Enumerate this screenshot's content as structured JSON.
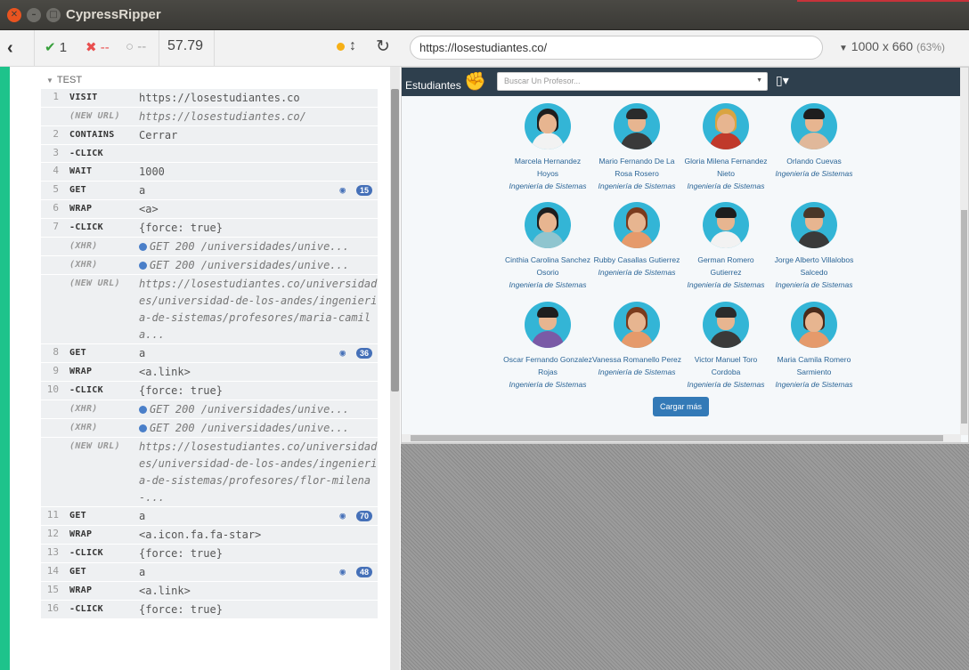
{
  "window": {
    "title": "CypressRipper"
  },
  "toolbar": {
    "passed": "1",
    "failed": "--",
    "pending": "--",
    "duration": "57.79",
    "url": "https://losestudiantes.co/",
    "viewport": "1000 x 660",
    "scale": "(63%)"
  },
  "log": {
    "test_title": "TEST",
    "commands": [
      {
        "num": "1",
        "name": "VISIT",
        "msg": "https://losestudiantes.co"
      },
      {
        "num": "",
        "name": "(NEW URL)",
        "msg": "https://losestudiantes.co/",
        "sub": true
      },
      {
        "num": "2",
        "name": "CONTAINS",
        "msg": "Cerrar"
      },
      {
        "num": "3",
        "name": "-CLICK",
        "msg": ""
      },
      {
        "num": "4",
        "name": "WAIT",
        "msg": "1000"
      },
      {
        "num": "5",
        "name": "GET",
        "msg": "a",
        "badge": "15"
      },
      {
        "num": "6",
        "name": "WRAP",
        "msg": "<a>"
      },
      {
        "num": "7",
        "name": "-CLICK",
        "msg": "{force: true}"
      },
      {
        "num": "",
        "name": "(XHR)",
        "msg": "GET 200 /universidades/unive...",
        "sub": true,
        "xhr": true
      },
      {
        "num": "",
        "name": "(XHR)",
        "msg": "GET 200 /universidades/unive...",
        "sub": true,
        "xhr": true
      },
      {
        "num": "",
        "name": "(NEW URL)",
        "msg": "https://losestudiantes.co/universidades/universidad-de-los-andes/ingenieria-de-sistemas/profesores/maria-camila...",
        "sub": true
      },
      {
        "num": "8",
        "name": "GET",
        "msg": "a",
        "badge": "36"
      },
      {
        "num": "9",
        "name": "WRAP",
        "msg": "<a.link>"
      },
      {
        "num": "10",
        "name": "-CLICK",
        "msg": "{force: true}"
      },
      {
        "num": "",
        "name": "(XHR)",
        "msg": "GET 200 /universidades/unive...",
        "sub": true,
        "xhr": true
      },
      {
        "num": "",
        "name": "(XHR)",
        "msg": "GET 200 /universidades/unive...",
        "sub": true,
        "xhr": true
      },
      {
        "num": "",
        "name": "(NEW URL)",
        "msg": "https://losestudiantes.co/universidades/universidad-de-los-andes/ingenieria-de-sistemas/profesores/flor-milena-...",
        "sub": true
      },
      {
        "num": "11",
        "name": "GET",
        "msg": "a",
        "badge": "70"
      },
      {
        "num": "12",
        "name": "WRAP",
        "msg": "<a.icon.fa.fa-star>"
      },
      {
        "num": "13",
        "name": "-CLICK",
        "msg": "{force: true}"
      },
      {
        "num": "14",
        "name": "GET",
        "msg": "a",
        "badge": "48"
      },
      {
        "num": "15",
        "name": "WRAP",
        "msg": "<a.link>"
      },
      {
        "num": "16",
        "name": "-CLICK",
        "msg": "{force: true}"
      }
    ]
  },
  "site": {
    "brand": "Estudiantes",
    "search_placeholder": "Buscar Un Profesor...",
    "load_more": "Cargar más",
    "professors": [
      {
        "name": "Marcela Hernandez Hoyos",
        "dept": "Ingeniería de Sistemas",
        "hair": "#1e1e1e",
        "shirt": "#f2f2f2",
        "female": true
      },
      {
        "name": "Mario Fernando De La Rosa Rosero",
        "dept": "Ingeniería de Sistemas",
        "hair": "#2b2b2b",
        "shirt": "#3a3a3a"
      },
      {
        "name": "Gloria Milena Fernandez Nieto",
        "dept": "Ingeniería de Sistemas",
        "hair": "#d9a441",
        "shirt": "#c0392b",
        "female": true
      },
      {
        "name": "Orlando Cuevas",
        "dept": "Ingeniería de Sistemas",
        "hair": "#1e1e1e",
        "shirt": "#e0b89a"
      },
      {
        "name": "Cinthia Carolina Sanchez Osorio",
        "dept": "Ingeniería de Sistemas",
        "hair": "#1e1e1e",
        "shirt": "#8fc5cf",
        "female": true
      },
      {
        "name": "Rubby Casallas Gutierrez",
        "dept": "Ingeniería de Sistemas",
        "hair": "#7a3b1d",
        "shirt": "#e59a6b",
        "female": true
      },
      {
        "name": "German Romero Gutierrez",
        "dept": "Ingeniería de Sistemas",
        "hair": "#1e1e1e",
        "shirt": "#f2f2f2"
      },
      {
        "name": "Jorge Alberto Villalobos Salcedo",
        "dept": "Ingeniería de Sistemas",
        "hair": "#4a3728",
        "shirt": "#3a3a3a"
      },
      {
        "name": "Oscar Fernando Gonzalez Rojas",
        "dept": "Ingeniería de Sistemas",
        "hair": "#1e1e1e",
        "shirt": "#7a5aa6"
      },
      {
        "name": "Vanessa Romanello Perez",
        "dept": "Ingeniería de Sistemas",
        "hair": "#7a3b1d",
        "shirt": "#e59a6b",
        "female": true
      },
      {
        "name": "Victor Manuel Toro Cordoba",
        "dept": "Ingeniería de Sistemas",
        "hair": "#2b2b2b",
        "shirt": "#3a3a3a"
      },
      {
        "name": "Maria Camila Romero Sarmiento",
        "dept": "Ingeniería de Sistemas",
        "hair": "#4a2a1a",
        "shirt": "#e59a6b",
        "female": true
      }
    ]
  }
}
